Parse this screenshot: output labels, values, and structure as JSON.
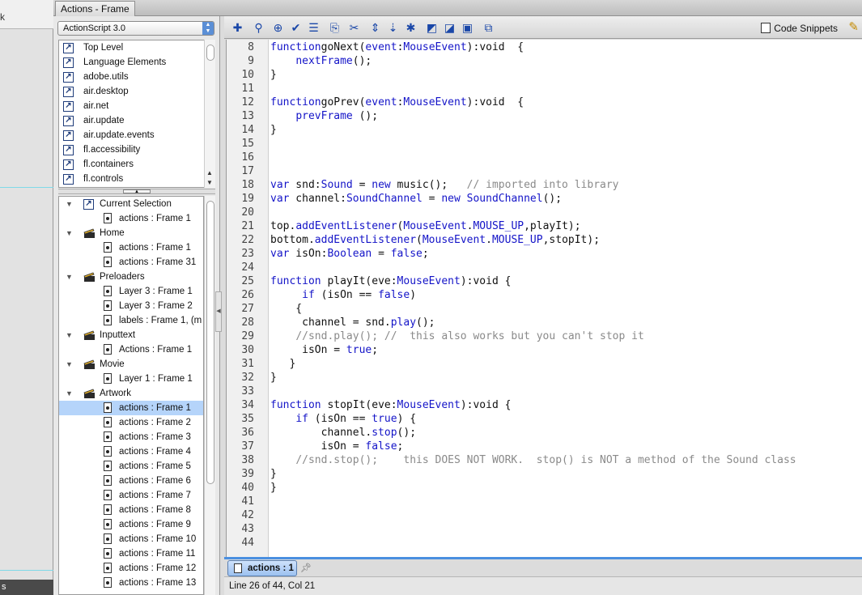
{
  "background": {
    "left_glyph": "k",
    "bottom_glyph": "s"
  },
  "window": {
    "title": "Actions - Frame"
  },
  "language_select": {
    "value": "ActionScript 3.0"
  },
  "library_items": [
    "Top Level",
    "Language Elements",
    "adobe.utils",
    "air.desktop",
    "air.net",
    "air.update",
    "air.update.events",
    "fl.accessibility",
    "fl.containers",
    "fl.controls"
  ],
  "nav_tree": [
    {
      "kind": "group",
      "icon": "current-selection-icon",
      "label": "Current Selection"
    },
    {
      "kind": "frame",
      "label": "actions : Frame 1"
    },
    {
      "kind": "group",
      "icon": "scene-icon",
      "label": "Home"
    },
    {
      "kind": "frame",
      "label": "actions : Frame 1"
    },
    {
      "kind": "frame",
      "label": "actions : Frame 31"
    },
    {
      "kind": "group",
      "icon": "scene-icon",
      "label": "Preloaders"
    },
    {
      "kind": "frame",
      "label": "Layer 3 : Frame 1"
    },
    {
      "kind": "frame",
      "label": "Layer 3 : Frame 2"
    },
    {
      "kind": "frame",
      "label": "labels : Frame 1, (m"
    },
    {
      "kind": "group",
      "icon": "scene-icon",
      "label": "Inputtext"
    },
    {
      "kind": "frame",
      "label": "Actions : Frame 1"
    },
    {
      "kind": "group",
      "icon": "scene-icon",
      "label": "Movie"
    },
    {
      "kind": "frame",
      "label": "Layer 1 : Frame 1"
    },
    {
      "kind": "group",
      "icon": "scene-icon",
      "label": "Artwork"
    },
    {
      "kind": "frame",
      "label": "actions : Frame 1",
      "selected": true
    },
    {
      "kind": "frame",
      "label": "actions : Frame 2"
    },
    {
      "kind": "frame",
      "label": "actions : Frame 3"
    },
    {
      "kind": "frame",
      "label": "actions : Frame 4"
    },
    {
      "kind": "frame",
      "label": "actions : Frame 5"
    },
    {
      "kind": "frame",
      "label": "actions : Frame 6"
    },
    {
      "kind": "frame",
      "label": "actions : Frame 7"
    },
    {
      "kind": "frame",
      "label": "actions : Frame 8"
    },
    {
      "kind": "frame",
      "label": "actions : Frame 9"
    },
    {
      "kind": "frame",
      "label": "actions : Frame 10"
    },
    {
      "kind": "frame",
      "label": "actions : Frame 11"
    },
    {
      "kind": "frame",
      "label": "actions : Frame 12"
    },
    {
      "kind": "frame",
      "label": "actions : Frame 13"
    }
  ],
  "toolbar": {
    "buttons": [
      "add-statement-icon",
      "find-icon",
      "insert-target-path-icon",
      "check-syntax-icon",
      "auto-format-icon",
      "show-code-hint-icon",
      "debug-options-icon",
      "collapse-between-braces-icon",
      "collapse-selection-icon",
      "expand-all-icon",
      "apply-block-comment-icon",
      "apply-line-comment-icon",
      "remove-comment-icon",
      "show-hide-toolbox-icon"
    ],
    "snippets_label": "Code Snippets",
    "wand_icon": "magic-wand-icon"
  },
  "code_lines": [
    {
      "n": "8",
      "segs": [
        [
          "kw",
          "function"
        ],
        [
          "",
          "goNext("
        ],
        [
          "ty",
          "event"
        ],
        [
          "",
          ":"
        ],
        [
          "ty",
          "MouseEvent"
        ],
        [
          "",
          ")"
        ],
        [
          "",
          ":void  {"
        ]
      ]
    },
    {
      "n": "9",
      "segs": [
        [
          "",
          "    "
        ],
        [
          "fn",
          "nextFrame"
        ],
        [
          "",
          "();"
        ]
      ]
    },
    {
      "n": "10",
      "segs": [
        [
          "",
          "}"
        ]
      ]
    },
    {
      "n": "11",
      "segs": []
    },
    {
      "n": "12",
      "segs": [
        [
          "kw",
          "function"
        ],
        [
          "",
          "goPrev("
        ],
        [
          "ty",
          "event"
        ],
        [
          "",
          ":"
        ],
        [
          "ty",
          "MouseEvent"
        ],
        [
          "",
          ")"
        ],
        [
          "",
          ":void  {"
        ]
      ]
    },
    {
      "n": "13",
      "segs": [
        [
          "",
          "    "
        ],
        [
          "fn",
          "prevFrame"
        ],
        [
          "",
          " ();"
        ]
      ]
    },
    {
      "n": "14",
      "segs": [
        [
          "",
          "}"
        ]
      ]
    },
    {
      "n": "15",
      "segs": []
    },
    {
      "n": "16",
      "segs": []
    },
    {
      "n": "17",
      "segs": []
    },
    {
      "n": "18",
      "segs": [
        [
          "kw",
          "var"
        ],
        [
          "",
          " snd:"
        ],
        [
          "ty",
          "Sound"
        ],
        [
          "",
          " = "
        ],
        [
          "kw",
          "new"
        ],
        [
          "",
          " music();   "
        ],
        [
          "cm",
          "// imported into library"
        ]
      ]
    },
    {
      "n": "19",
      "segs": [
        [
          "kw",
          "var"
        ],
        [
          "",
          " channel:"
        ],
        [
          "ty",
          "SoundChannel"
        ],
        [
          "",
          " = "
        ],
        [
          "kw",
          "new"
        ],
        [
          "",
          " "
        ],
        [
          "ty",
          "SoundChannel"
        ],
        [
          "",
          "();"
        ]
      ]
    },
    {
      "n": "20",
      "segs": []
    },
    {
      "n": "21",
      "segs": [
        [
          "",
          "top."
        ],
        [
          "fn",
          "addEventListener"
        ],
        [
          "",
          "("
        ],
        [
          "ty",
          "MouseEvent"
        ],
        [
          "",
          "."
        ],
        [
          "ty",
          "MOUSE_UP"
        ],
        [
          "",
          ",playIt);"
        ]
      ]
    },
    {
      "n": "22",
      "segs": [
        [
          "",
          "bottom."
        ],
        [
          "fn",
          "addEventListener"
        ],
        [
          "",
          "("
        ],
        [
          "ty",
          "MouseEvent"
        ],
        [
          "",
          "."
        ],
        [
          "ty",
          "MOUSE_UP"
        ],
        [
          "",
          ",stopIt);"
        ]
      ]
    },
    {
      "n": "23",
      "segs": [
        [
          "kw",
          "var"
        ],
        [
          "",
          " isOn:"
        ],
        [
          "ty",
          "Boolean"
        ],
        [
          "",
          " = "
        ],
        [
          "kw",
          "false"
        ],
        [
          "",
          ";"
        ]
      ]
    },
    {
      "n": "24",
      "segs": []
    },
    {
      "n": "25",
      "segs": [
        [
          "kw",
          "function"
        ],
        [
          "",
          " playIt(eve:"
        ],
        [
          "ty",
          "MouseEvent"
        ],
        [
          "",
          "):void {"
        ]
      ]
    },
    {
      "n": "26",
      "segs": [
        [
          "",
          "     "
        ],
        [
          "kw",
          "if"
        ],
        [
          "",
          " (isOn == "
        ],
        [
          "kw",
          "false"
        ],
        [
          "",
          ")"
        ]
      ]
    },
    {
      "n": "27",
      "segs": [
        [
          "",
          "    {"
        ]
      ]
    },
    {
      "n": "28",
      "segs": [
        [
          "",
          "     channel = snd."
        ],
        [
          "fn",
          "play"
        ],
        [
          "",
          "();"
        ]
      ]
    },
    {
      "n": "29",
      "segs": [
        [
          "",
          "    "
        ],
        [
          "cm",
          "//snd.play(); //  this also works but you can't stop it"
        ]
      ]
    },
    {
      "n": "30",
      "segs": [
        [
          "",
          "     isOn = "
        ],
        [
          "kw",
          "true"
        ],
        [
          "",
          ";"
        ]
      ]
    },
    {
      "n": "31",
      "segs": [
        [
          "",
          "   }"
        ]
      ]
    },
    {
      "n": "32",
      "segs": [
        [
          "",
          "}"
        ]
      ]
    },
    {
      "n": "33",
      "segs": []
    },
    {
      "n": "34",
      "segs": [
        [
          "kw",
          "function"
        ],
        [
          "",
          " stopIt(eve:"
        ],
        [
          "ty",
          "MouseEvent"
        ],
        [
          "",
          "):void {"
        ]
      ]
    },
    {
      "n": "35",
      "segs": [
        [
          "",
          "    "
        ],
        [
          "kw",
          "if"
        ],
        [
          "",
          " (isOn == "
        ],
        [
          "kw",
          "true"
        ],
        [
          "",
          ") {"
        ]
      ]
    },
    {
      "n": "36",
      "segs": [
        [
          "",
          "        channel."
        ],
        [
          "fn",
          "stop"
        ],
        [
          "",
          "();"
        ]
      ]
    },
    {
      "n": "37",
      "segs": [
        [
          "",
          "        isOn = "
        ],
        [
          "kw",
          "false"
        ],
        [
          "",
          ";"
        ]
      ]
    },
    {
      "n": "38",
      "segs": [
        [
          "",
          "    "
        ],
        [
          "cm",
          "//snd.stop();    this DOES NOT WORK.  stop() is NOT a method of the Sound class"
        ]
      ]
    },
    {
      "n": "39",
      "segs": [
        [
          "",
          "}"
        ]
      ]
    },
    {
      "n": "40",
      "segs": [
        [
          "",
          "}"
        ]
      ]
    },
    {
      "n": "41",
      "segs": []
    },
    {
      "n": "42",
      "segs": []
    },
    {
      "n": "43",
      "segs": []
    },
    {
      "n": "44",
      "segs": []
    }
  ],
  "bottom_tab": {
    "label": "actions : 1",
    "pin_icon": "pin-script-icon"
  },
  "status": {
    "text": "Line 26 of 44, Col 21"
  }
}
